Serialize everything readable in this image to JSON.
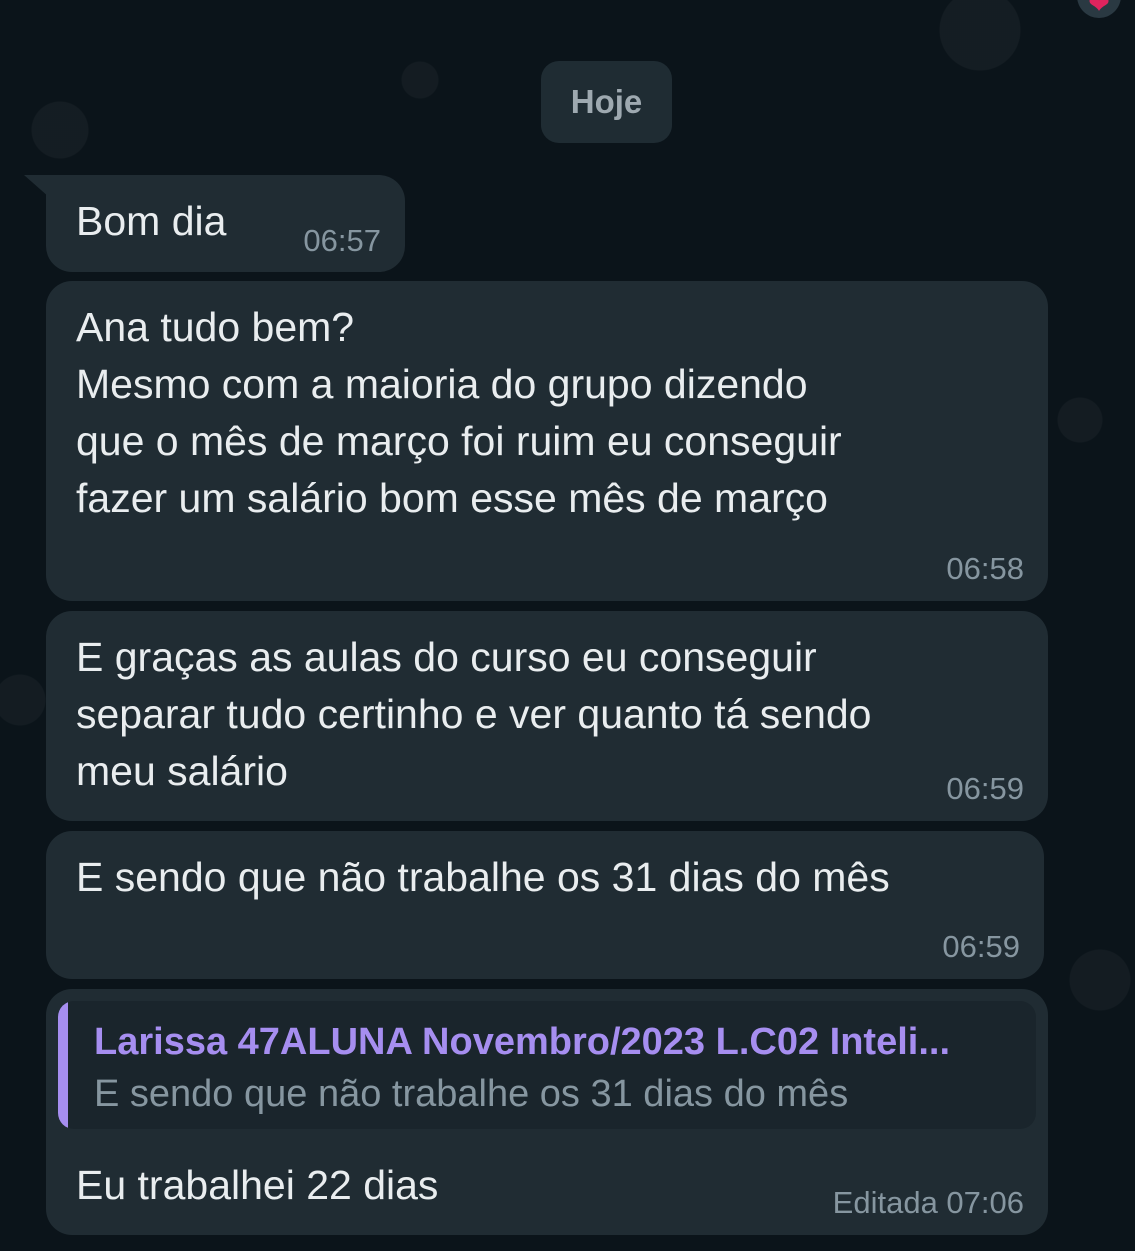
{
  "date_separator": "Hoje",
  "reaction": "❤",
  "messages": [
    {
      "text": "Bom dia",
      "time": "06:57"
    },
    {
      "text": "Ana tudo bem?\nMesmo com a maioria do grupo dizendo\nque o mês de março foi ruim eu conseguir\nfazer um salário bom esse mês de março",
      "time": "06:58"
    },
    {
      "text": "E graças as aulas do curso eu conseguir\nseparar tudo certinho e ver quanto tá sendo\nmeu salário",
      "time": "06:59"
    },
    {
      "text": "E sendo que não trabalhe os 31 dias do mês",
      "time": "06:59"
    },
    {
      "quote": {
        "author": "Larissa 47ALUNA Novembro/2023 L.C02 Inteli...",
        "text": "E sendo que não trabalhe os 31 dias do mês"
      },
      "text": "Eu trabalhei 22 dias",
      "time": "Editada 07:06"
    }
  ],
  "colors": {
    "background": "#0b141a",
    "bubble": "#202c33",
    "quote_accent": "#a68ef0",
    "timestamp": "#8696a0"
  }
}
